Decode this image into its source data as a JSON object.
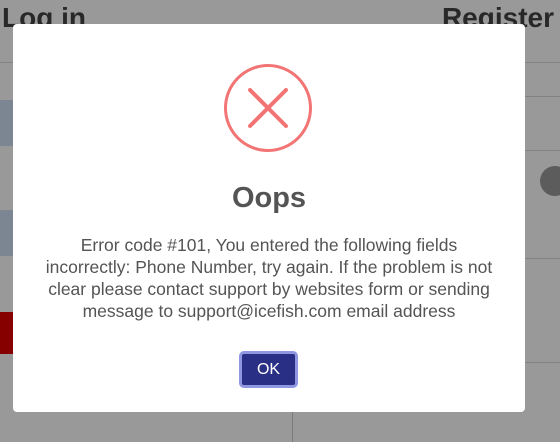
{
  "background": {
    "login_heading": "Log in",
    "register_heading": "Register"
  },
  "dialog": {
    "icon": "error-x-circle-icon",
    "title": "Oops",
    "message": "Error code #101, You entered the following fields incorrectly: Phone Number, try again. If the problem is not clear please contact support by websites form or sending message to support@icefish.com email address",
    "ok_label": "OK"
  },
  "colors": {
    "error_red": "#f27474",
    "ok_button": "#2a2f86",
    "overlay": "rgba(0,0,0,0.4)"
  }
}
